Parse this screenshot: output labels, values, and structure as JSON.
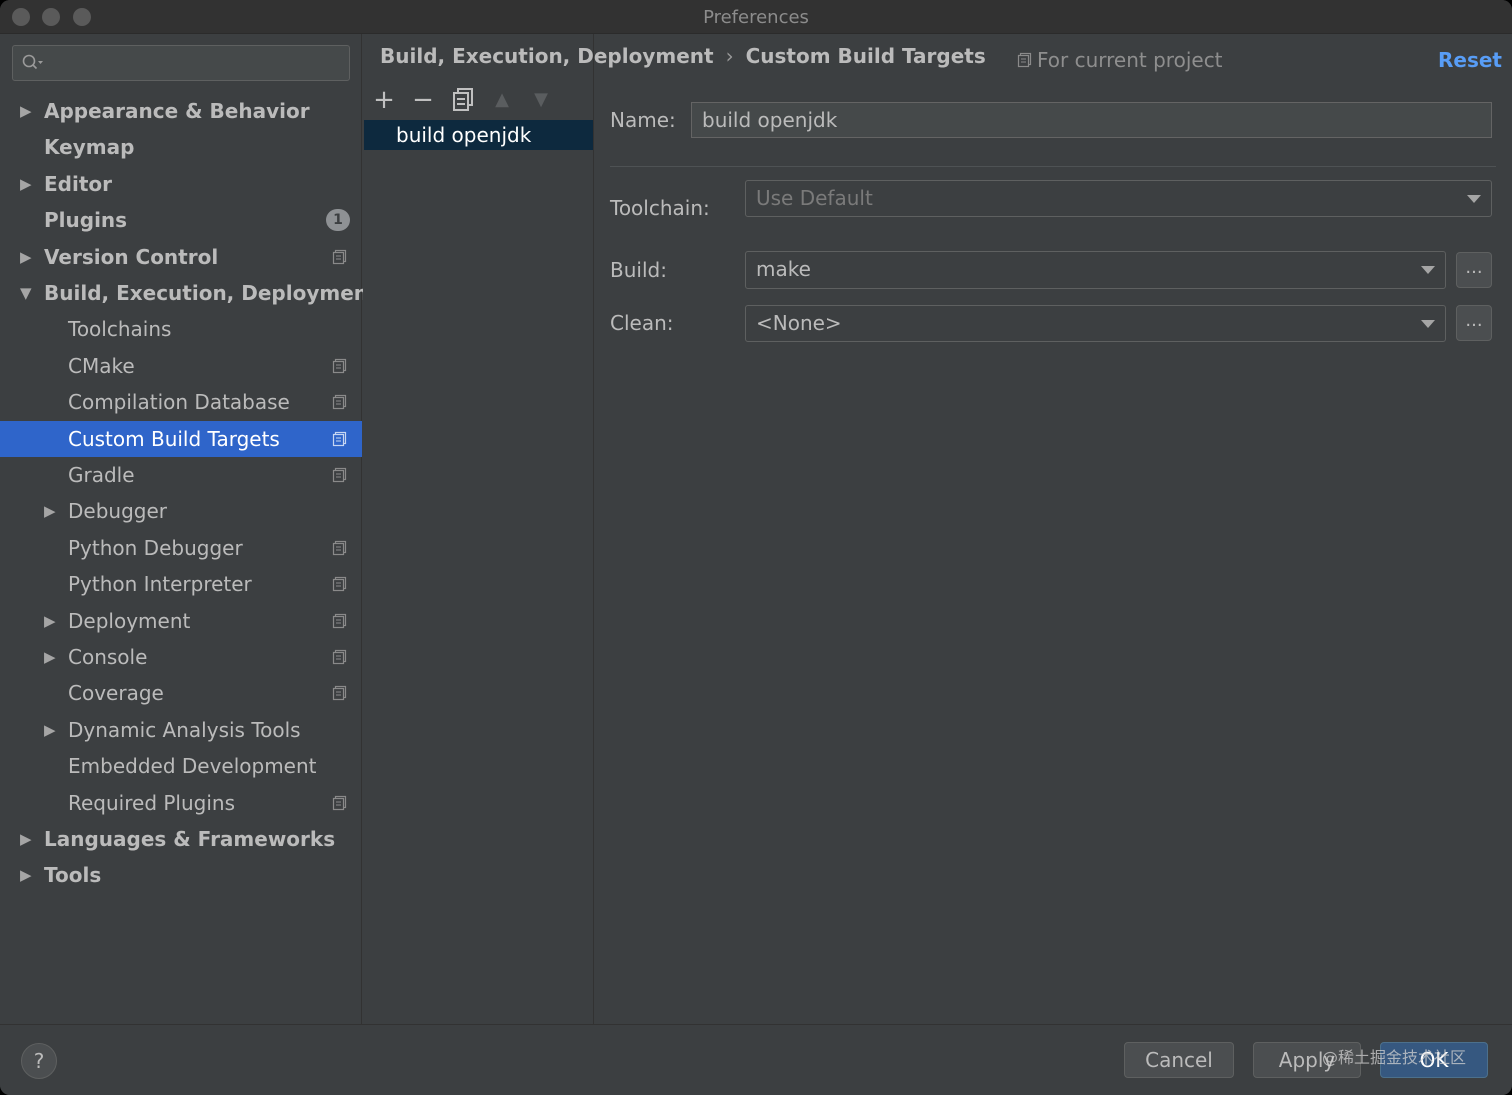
{
  "window": {
    "title": "Preferences"
  },
  "search": {
    "value": ""
  },
  "sidebar": {
    "items": [
      {
        "label": "Appearance & Behavior"
      },
      {
        "label": "Keymap"
      },
      {
        "label": "Editor"
      },
      {
        "label": "Plugins",
        "badge": "1"
      },
      {
        "label": "Version Control"
      },
      {
        "label": "Build, Execution, Deployment"
      },
      {
        "label": "Toolchains"
      },
      {
        "label": "CMake"
      },
      {
        "label": "Compilation Database"
      },
      {
        "label": "Custom Build Targets"
      },
      {
        "label": "Gradle"
      },
      {
        "label": "Debugger"
      },
      {
        "label": "Python Debugger"
      },
      {
        "label": "Python Interpreter"
      },
      {
        "label": "Deployment"
      },
      {
        "label": "Console"
      },
      {
        "label": "Coverage"
      },
      {
        "label": "Dynamic Analysis Tools"
      },
      {
        "label": "Embedded Development"
      },
      {
        "label": "Required Plugins"
      },
      {
        "label": "Languages & Frameworks"
      },
      {
        "label": "Tools"
      }
    ]
  },
  "breadcrumb": {
    "parent": "Build, Execution, Deployment",
    "separator": "›",
    "current": "Custom Build Targets"
  },
  "scope": {
    "label": "For current project"
  },
  "reset_label": "Reset",
  "toolbar": {
    "add": "+",
    "remove": "−",
    "up": "▲",
    "down": "▼"
  },
  "targets": {
    "items": [
      {
        "label": "build openjdk"
      }
    ]
  },
  "form": {
    "name_label": "Name:",
    "name_value": "build openjdk",
    "toolchain_label": "Toolchain:",
    "toolchain_value": "Use Default",
    "build_label": "Build:",
    "build_value": "make",
    "clean_label": "Clean:",
    "clean_value": "<None>",
    "ellipsis": "..."
  },
  "footer": {
    "help": "?",
    "cancel": "Cancel",
    "apply": "Apply",
    "ok": "OK",
    "watermark": "@稀土掘金技术社区"
  },
  "colors": {
    "selection": "#2f65ca",
    "link": "#589df6",
    "list_selection": "#0d293e",
    "default_button": "#365880"
  }
}
